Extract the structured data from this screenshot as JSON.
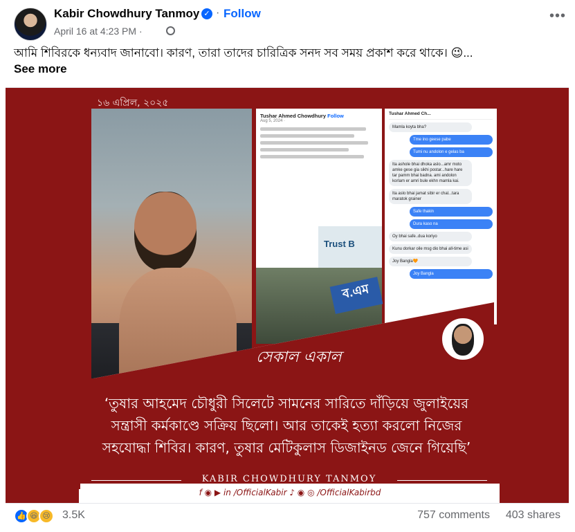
{
  "post": {
    "author": "Kabir Chowdhury Tanmoy",
    "follow_label": "Follow",
    "timestamp": "April 16 at 4:23 PM ·",
    "caption": "আমি শিবিরকে ধন্যবাদ জানাবো। কারণ, তারা তাদের চারিত্রিক সনদ সব সময় প্রকাশ করে থাকে। 😉...",
    "see_more": "See more"
  },
  "icons": {
    "verified": "verified-badge-icon",
    "globe": "globe-icon",
    "more": "more-options-icon",
    "close": "close-icon"
  },
  "media": {
    "date_label": "১৬ এপ্রিল, ২০২৫",
    "screenshot_a": {
      "name": "Tushar Ahmed Chowdhury",
      "follow": "Follow",
      "date": "Aug 5, 2024 ·",
      "sign_text": "Trust B",
      "banner_text": "ব.এম"
    },
    "screenshot_b": {
      "contact": "Tushar Ahmed Ch...",
      "messages": [
        {
          "dir": "in",
          "text": "Mamla koyta bha?"
        },
        {
          "dir": "out",
          "text": "Tme ino geese pabe"
        },
        {
          "dir": "out",
          "text": "Tumi nu andolon e gelas ba"
        },
        {
          "dir": "in",
          "text": "Ita ashole bhai dhoka aslo...amr moto amke gese gia sikhi postar...hare hare tar pamm bhai badna. ami andolon korlam er amri bule ekhn mamla kai."
        },
        {
          "dir": "in",
          "text": "Ita aslo bhai jamat sibir er chal...tara maratok grainer"
        },
        {
          "dir": "out",
          "text": "Safe thakin"
        },
        {
          "dir": "out",
          "text": "Dura kaso na"
        },
        {
          "dir": "in",
          "text": "Oy bhai safe..dua koriyo"
        },
        {
          "dir": "in",
          "text": "Kunu dorkar oile msg dio bhai all-time asi"
        },
        {
          "dir": "in",
          "text": "Joy Bangla🧡"
        },
        {
          "dir": "out",
          "text": "Joy Bangla"
        }
      ]
    },
    "sekal_text": "সেকাল একাল",
    "quote": "‘তুষার আহমেদ চৌধুরী সিলেটে সামনের সারিতে দাঁড়িয়ে জুলাইয়ের সন্ত্রাসী কর্মকাণ্ডে সক্রিয় ছিলো। আর তাকেই হত্যা করলো নিজের সহযোদ্ধা শিবির। কারণ, তুষার মেটিকুলাস ডিজাইনড জেনে গিয়েছি’",
    "signature": "KABIR CHOWDHURY TANMOY",
    "handles": "f ◉ ▶ in /OfficialKabir  ♪ ◉ ◎ /OfficialKabirbd"
  },
  "footer": {
    "reaction_count": "3.5K",
    "comments": "757 comments",
    "shares": "403 shares",
    "reactions": [
      "like",
      "haha",
      "sad"
    ]
  },
  "colors": {
    "brand_blue": "#0866ff",
    "poster_red": "#8b1515",
    "meta_gray": "#65676b"
  }
}
